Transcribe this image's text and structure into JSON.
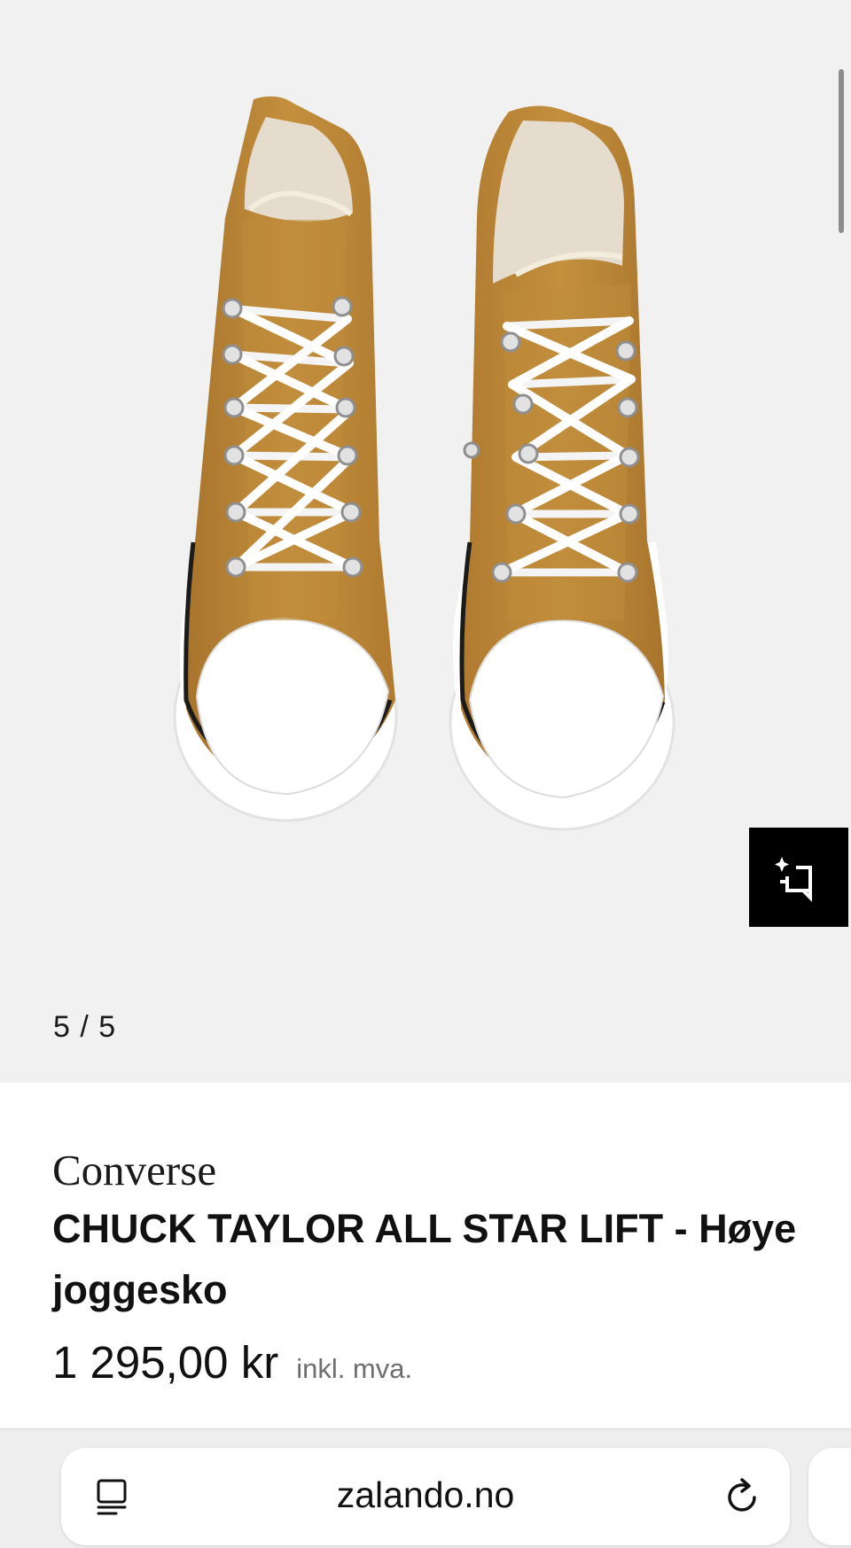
{
  "gallery": {
    "counter": "5 / 5",
    "image_icon": "sneaker-pair-photo",
    "ai_button_icon": "ai-crop-icon",
    "background": "#f1f1f1",
    "shoe_color": "#c08a3a"
  },
  "product": {
    "brand": "Converse",
    "name": "CHUCK TAYLOR ALL STAR LIFT - Høye joggesko",
    "price": "1 295,00 kr",
    "tax_note": "inkl. mva."
  },
  "browser": {
    "url": "zalando.no",
    "reader_icon": "reader-icon",
    "reload_icon": "reload-icon"
  }
}
